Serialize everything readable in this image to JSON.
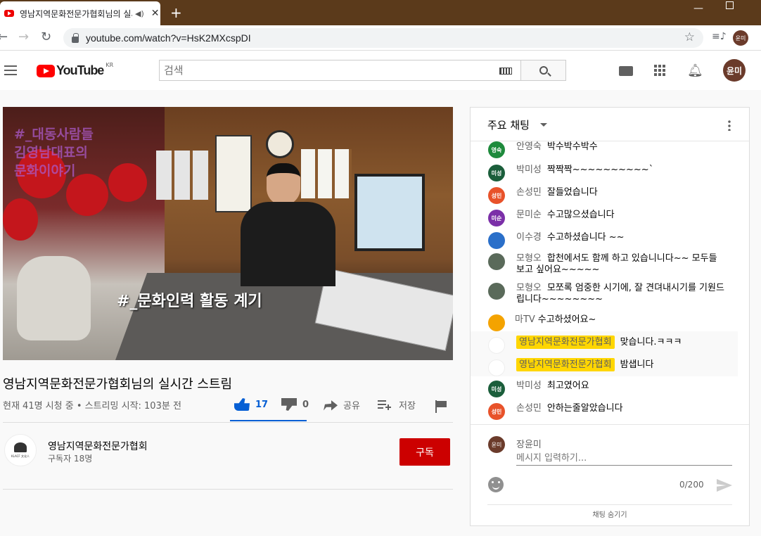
{
  "browser": {
    "tab_title": "영남지역문화전문가협회님의 실시간 스트림",
    "url": "youtube.com/watch?v=HsK2MXcspDI",
    "profile_initials": "윤미"
  },
  "header": {
    "logo_text": "YouTube",
    "logo_region": "KR",
    "search_placeholder": "검색",
    "avatar_initials": "윤미"
  },
  "video": {
    "overlay_top": "#_대동사람들\n김영남대표의\n문화이야기",
    "overlay_caption": "#_문화인력 활동 계기",
    "title": "영남지역문화전문가협회님의 실시간 스트림",
    "meta": "현재 41명 시청 중 • 스트리밍 시작: 103분 전",
    "likes": "17",
    "dislikes": "0",
    "share_label": "공유",
    "save_label": "저장"
  },
  "channel": {
    "name": "영남지역문화전문가협회",
    "subscribers": "구독자 18명",
    "subscribe_label": "구독",
    "avatar_text": "KLACF 文化人"
  },
  "chat": {
    "header": "주요 채팅",
    "messages": [
      {
        "author": "안영숙",
        "text": "박수박수박수",
        "initials": "영숙",
        "color": "#1e8a3c"
      },
      {
        "author": "박미성",
        "text": "짝짝짝~~~~~~~~~~`",
        "initials": "미성",
        "color": "#1b5e3b"
      },
      {
        "author": "손성민",
        "text": "잘들었습니다",
        "initials": "성민",
        "color": "#e8522a"
      },
      {
        "author": "문미순",
        "text": "수고많으셨습니다",
        "initials": "미순",
        "color": "#7b2fa8"
      },
      {
        "author": "이수경",
        "text": "수고하셨습니다 ~~",
        "initials": "",
        "color": "#2a6fc9"
      },
      {
        "author": "모형오",
        "text": "합천에서도 함께 하고 있습니니다~~ 모두들 보고 싶어요~~~~~",
        "initials": "",
        "color": "#5a6a5a"
      },
      {
        "author": "모형오",
        "text": "모쪼록 엄중한 시기에, 잘 견뎌내시기를 기원드립니다~~~~~~~~",
        "initials": "",
        "color": "#5a6a5a"
      },
      {
        "author": "마TV",
        "text": "수고하셨어요~",
        "initials": "",
        "color": "#f4a300"
      },
      {
        "author": "영남지역문화전문가협회",
        "text": "맞습니다.ㅋㅋㅋ",
        "initials": "",
        "color": "#ffffff",
        "owner": true
      },
      {
        "author": "영남지역문화전문가협회",
        "text": "밤샙니다",
        "initials": "",
        "color": "#ffffff",
        "owner": true
      },
      {
        "author": "박미성",
        "text": "최고였어요",
        "initials": "미성",
        "color": "#1b5e3b"
      },
      {
        "author": "손성민",
        "text": "안하는줄알았습니다",
        "initials": "성민",
        "color": "#e8522a"
      }
    ],
    "my_name": "장윤미",
    "my_initials": "윤미",
    "input_placeholder": "메시지 입력하기...",
    "counter": "0/200",
    "hide_chat": "채팅 숨기기"
  }
}
